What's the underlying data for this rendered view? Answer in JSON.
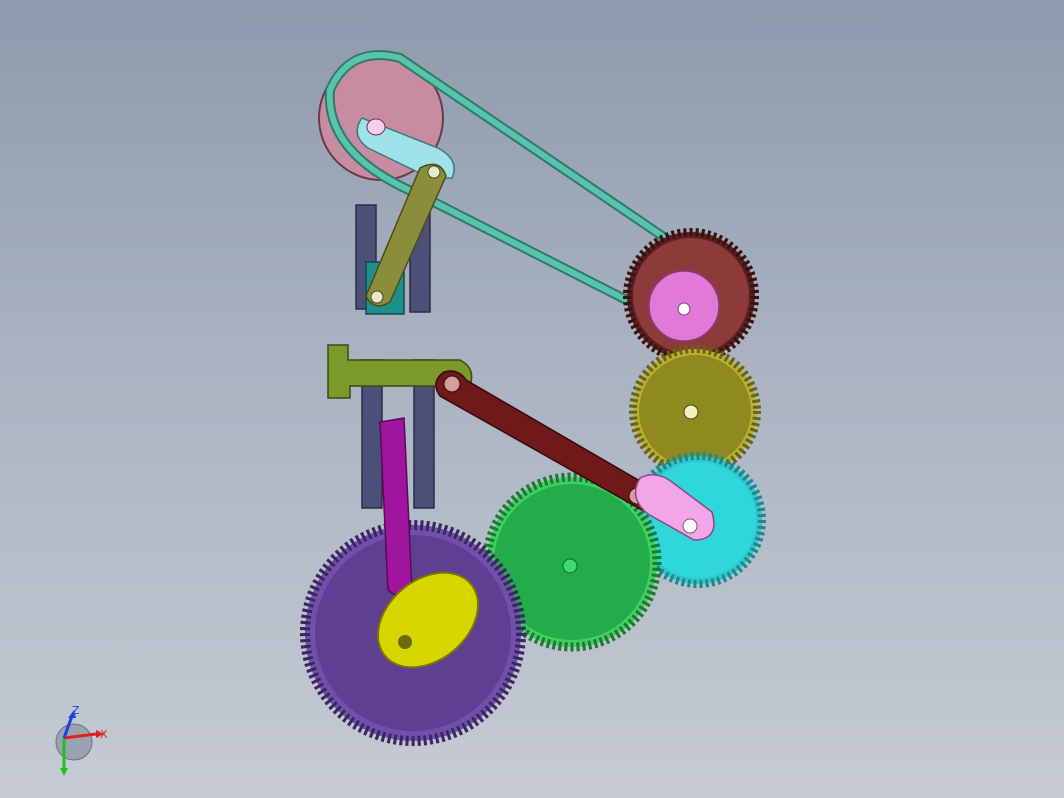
{
  "scene": {
    "description_visible": false,
    "colors": {
      "background_top": "#8e9aad",
      "background_bottom": "#c6cbd3",
      "belt": "#3fa38c",
      "large_pulley": "#c88ca0",
      "top_crank": "#9fe3e8",
      "olive_link": "#8a8d3a",
      "slider_block": "#1f8f8a",
      "guide_rails": "#4b5078",
      "maroon_gear": "#8c3a3a",
      "pink_hub": "#e07ad6",
      "olive_gear": "#8f8a1f",
      "cyan_gear": "#2fd6dc",
      "green_gear": "#22ad4a",
      "purple_gear": "#5e3f91",
      "yellow_cam": "#d8d600",
      "magenta_follower": "#a0159e",
      "connecting_rod": "#6e1a1a",
      "pink_crank": "#f2a6ea",
      "green_bracket": "#7a9a2a"
    }
  },
  "triad": {
    "x_label": "X",
    "z_label": "Z",
    "x_color": "#e02020",
    "y_color": "#20c020",
    "z_color": "#2040e0"
  }
}
